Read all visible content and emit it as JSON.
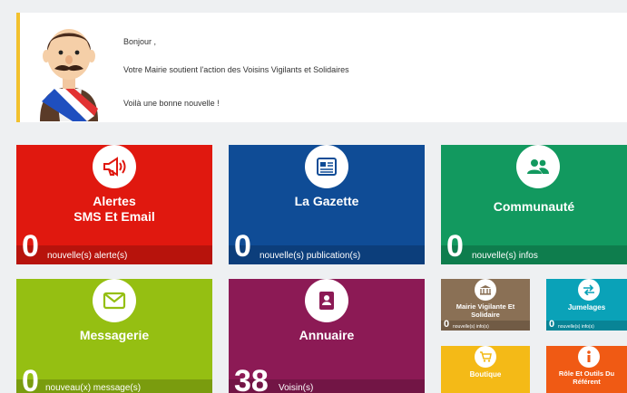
{
  "banner": {
    "greeting": "Bonjour  ,",
    "line1": "Votre Mairie soutient l'action des Voisins Vigilants et Solidaires",
    "line2": "Voilà une bonne nouvelle !"
  },
  "tiles": {
    "alertes": {
      "title1": "Alertes",
      "title2": "SMS Et Email",
      "count": "0",
      "label": "nouvelle(s) alerte(s)",
      "color": "#e0180f",
      "icon": "megaphone-icon"
    },
    "gazette": {
      "title": "La Gazette",
      "count": "0",
      "label": "nouvelle(s) publication(s)",
      "color": "#0f4c96",
      "icon": "newspaper-icon"
    },
    "communaute": {
      "title": "Communauté",
      "count": "0",
      "label": "nouvelle(s) infos",
      "color": "#12995f",
      "icon": "people-icon"
    },
    "messagerie": {
      "title": "Messagerie",
      "count": "0",
      "label": "nouveau(x) message(s)",
      "color": "#95bf12",
      "icon": "envelope-icon"
    },
    "annuaire": {
      "title": "Annuaire",
      "count": "38",
      "label": "Voisin(s)",
      "color": "#8c1a55",
      "icon": "contact-book-icon"
    },
    "mairie": {
      "title1": "Mairie Vigilante Et",
      "title2": "Solidaire",
      "count": "0",
      "label": "nouvelle(s) info(s)",
      "color": "#8a7055",
      "icon": "townhall-icon"
    },
    "jumelages": {
      "title": "Jumelages",
      "count": "0",
      "label": "nouvelle(s) info(s)",
      "color": "#0aa2b8",
      "icon": "exchange-arrows-icon"
    },
    "boutique": {
      "title": "Boutique",
      "color": "#f4ba17",
      "icon": "cart-icon"
    },
    "role": {
      "title1": "Rôle Et Outils Du",
      "title2": "Référent",
      "color": "#f05a14",
      "icon": "info-icon"
    }
  }
}
